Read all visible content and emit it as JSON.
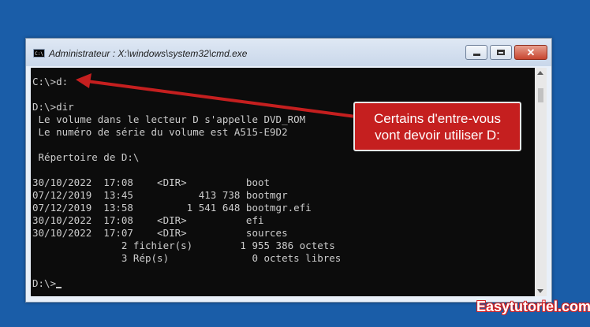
{
  "window": {
    "title": "Administrateur : X:\\windows\\system32\\cmd.exe",
    "icon": "cmd-icon",
    "buttons": {
      "minimize": "minimize-icon",
      "maximize": "maximize-icon",
      "close": "close-icon"
    }
  },
  "console": {
    "lines": [
      "C:\\>d:",
      "",
      "D:\\>dir",
      " Le volume dans le lecteur D s'appelle DVD_ROM",
      " Le numéro de série du volume est A515-E9D2",
      "",
      " Répertoire de D:\\",
      "",
      "30/10/2022  17:08    <DIR>          boot",
      "07/12/2019  13:45           413 738 bootmgr",
      "07/12/2019  13:58         1 541 648 bootmgr.efi",
      "30/10/2022  17:08    <DIR>          efi",
      "30/10/2022  17:07    <DIR>          sources",
      "               2 fichier(s)        1 955 386 octets",
      "               3 Rép(s)              0 octets libres",
      "",
      "D:\\>"
    ]
  },
  "callout": {
    "line1": "Certains d'entre-vous",
    "line2": "vont devoir utiliser D:",
    "color": "#c51f1f"
  },
  "watermark": "Easytutoriel.com",
  "colors": {
    "desktop": "#1a5da8",
    "console_bg": "#0c0c0c",
    "console_text": "#cccccc",
    "arrow": "#c51f1f"
  }
}
